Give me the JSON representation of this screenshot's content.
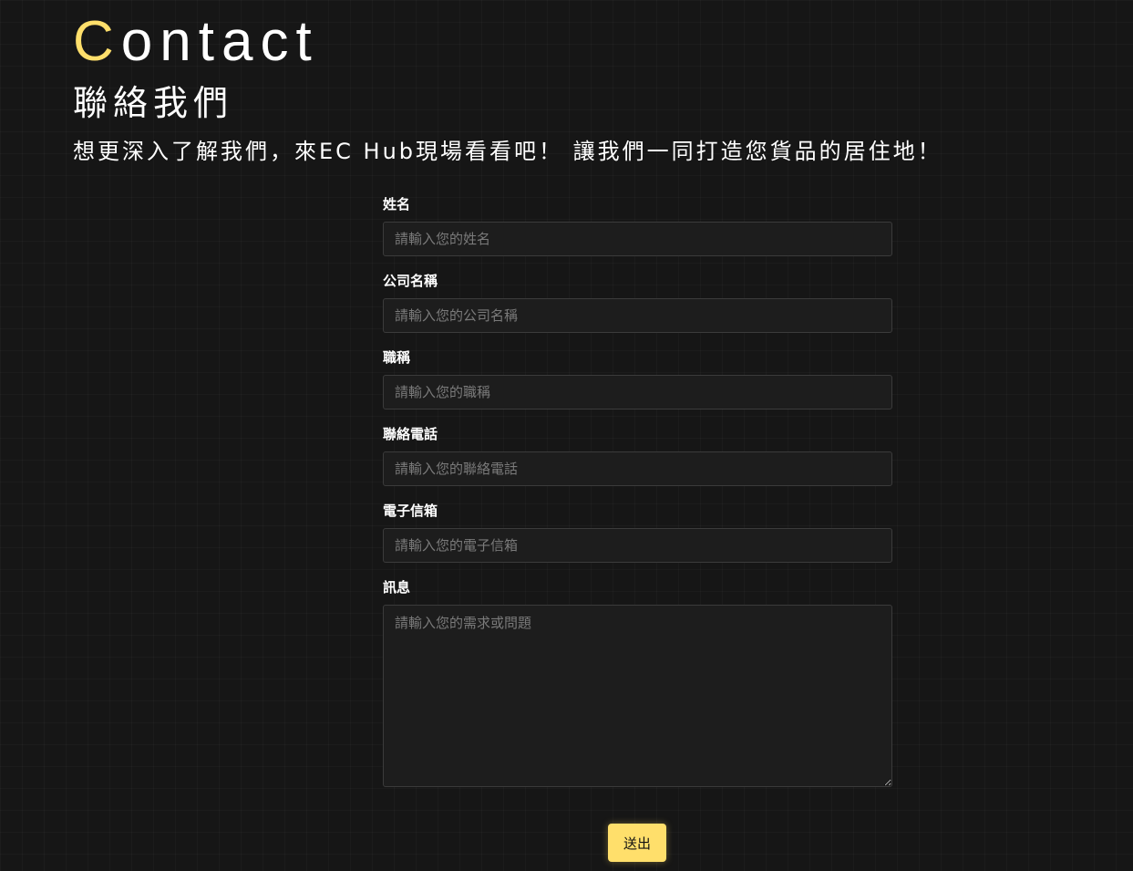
{
  "hero": {
    "title_first_letter": "C",
    "title_rest": "ontact",
    "title_zh": "聯絡我們",
    "tagline": "想更深入了解我們，來EC Hub現場看看吧！ 讓我們一同打造您貨品的居住地！"
  },
  "form": {
    "fields": [
      {
        "label": "姓名",
        "placeholder": "請輸入您的姓名"
      },
      {
        "label": "公司名稱",
        "placeholder": "請輸入您的公司名稱"
      },
      {
        "label": "職稱",
        "placeholder": "請輸入您的職稱"
      },
      {
        "label": "聯絡電話",
        "placeholder": "請輸入您的聯絡電話"
      },
      {
        "label": "電子信箱",
        "placeholder": "請輸入您的電子信箱"
      },
      {
        "label": "訊息",
        "placeholder": "請輸入您的需求或問題"
      }
    ],
    "submit_label": "送出"
  },
  "colors": {
    "background": "#161616",
    "accent": "#ffdf6b",
    "text": "#ffffff",
    "placeholder": "#7a7a7a",
    "input_border": "#3b3b3b"
  }
}
